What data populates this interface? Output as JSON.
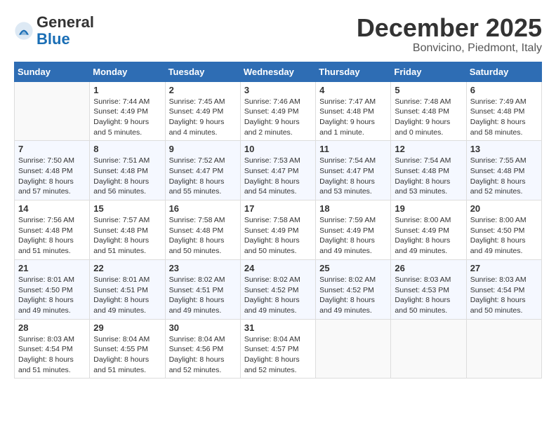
{
  "logo": {
    "general": "General",
    "blue": "Blue"
  },
  "header": {
    "month": "December 2025",
    "location": "Bonvicino, Piedmont, Italy"
  },
  "weekdays": [
    "Sunday",
    "Monday",
    "Tuesday",
    "Wednesday",
    "Thursday",
    "Friday",
    "Saturday"
  ],
  "weeks": [
    [
      {
        "day": "",
        "info": ""
      },
      {
        "day": "1",
        "info": "Sunrise: 7:44 AM\nSunset: 4:49 PM\nDaylight: 9 hours\nand 5 minutes."
      },
      {
        "day": "2",
        "info": "Sunrise: 7:45 AM\nSunset: 4:49 PM\nDaylight: 9 hours\nand 4 minutes."
      },
      {
        "day": "3",
        "info": "Sunrise: 7:46 AM\nSunset: 4:49 PM\nDaylight: 9 hours\nand 2 minutes."
      },
      {
        "day": "4",
        "info": "Sunrise: 7:47 AM\nSunset: 4:48 PM\nDaylight: 9 hours\nand 1 minute."
      },
      {
        "day": "5",
        "info": "Sunrise: 7:48 AM\nSunset: 4:48 PM\nDaylight: 9 hours\nand 0 minutes."
      },
      {
        "day": "6",
        "info": "Sunrise: 7:49 AM\nSunset: 4:48 PM\nDaylight: 8 hours\nand 58 minutes."
      }
    ],
    [
      {
        "day": "7",
        "info": "Sunrise: 7:50 AM\nSunset: 4:48 PM\nDaylight: 8 hours\nand 57 minutes."
      },
      {
        "day": "8",
        "info": "Sunrise: 7:51 AM\nSunset: 4:48 PM\nDaylight: 8 hours\nand 56 minutes."
      },
      {
        "day": "9",
        "info": "Sunrise: 7:52 AM\nSunset: 4:47 PM\nDaylight: 8 hours\nand 55 minutes."
      },
      {
        "day": "10",
        "info": "Sunrise: 7:53 AM\nSunset: 4:47 PM\nDaylight: 8 hours\nand 54 minutes."
      },
      {
        "day": "11",
        "info": "Sunrise: 7:54 AM\nSunset: 4:47 PM\nDaylight: 8 hours\nand 53 minutes."
      },
      {
        "day": "12",
        "info": "Sunrise: 7:54 AM\nSunset: 4:48 PM\nDaylight: 8 hours\nand 53 minutes."
      },
      {
        "day": "13",
        "info": "Sunrise: 7:55 AM\nSunset: 4:48 PM\nDaylight: 8 hours\nand 52 minutes."
      }
    ],
    [
      {
        "day": "14",
        "info": "Sunrise: 7:56 AM\nSunset: 4:48 PM\nDaylight: 8 hours\nand 51 minutes."
      },
      {
        "day": "15",
        "info": "Sunrise: 7:57 AM\nSunset: 4:48 PM\nDaylight: 8 hours\nand 51 minutes."
      },
      {
        "day": "16",
        "info": "Sunrise: 7:58 AM\nSunset: 4:48 PM\nDaylight: 8 hours\nand 50 minutes."
      },
      {
        "day": "17",
        "info": "Sunrise: 7:58 AM\nSunset: 4:49 PM\nDaylight: 8 hours\nand 50 minutes."
      },
      {
        "day": "18",
        "info": "Sunrise: 7:59 AM\nSunset: 4:49 PM\nDaylight: 8 hours\nand 49 minutes."
      },
      {
        "day": "19",
        "info": "Sunrise: 8:00 AM\nSunset: 4:49 PM\nDaylight: 8 hours\nand 49 minutes."
      },
      {
        "day": "20",
        "info": "Sunrise: 8:00 AM\nSunset: 4:50 PM\nDaylight: 8 hours\nand 49 minutes."
      }
    ],
    [
      {
        "day": "21",
        "info": "Sunrise: 8:01 AM\nSunset: 4:50 PM\nDaylight: 8 hours\nand 49 minutes."
      },
      {
        "day": "22",
        "info": "Sunrise: 8:01 AM\nSunset: 4:51 PM\nDaylight: 8 hours\nand 49 minutes."
      },
      {
        "day": "23",
        "info": "Sunrise: 8:02 AM\nSunset: 4:51 PM\nDaylight: 8 hours\nand 49 minutes."
      },
      {
        "day": "24",
        "info": "Sunrise: 8:02 AM\nSunset: 4:52 PM\nDaylight: 8 hours\nand 49 minutes."
      },
      {
        "day": "25",
        "info": "Sunrise: 8:02 AM\nSunset: 4:52 PM\nDaylight: 8 hours\nand 49 minutes."
      },
      {
        "day": "26",
        "info": "Sunrise: 8:03 AM\nSunset: 4:53 PM\nDaylight: 8 hours\nand 50 minutes."
      },
      {
        "day": "27",
        "info": "Sunrise: 8:03 AM\nSunset: 4:54 PM\nDaylight: 8 hours\nand 50 minutes."
      }
    ],
    [
      {
        "day": "28",
        "info": "Sunrise: 8:03 AM\nSunset: 4:54 PM\nDaylight: 8 hours\nand 51 minutes."
      },
      {
        "day": "29",
        "info": "Sunrise: 8:04 AM\nSunset: 4:55 PM\nDaylight: 8 hours\nand 51 minutes."
      },
      {
        "day": "30",
        "info": "Sunrise: 8:04 AM\nSunset: 4:56 PM\nDaylight: 8 hours\nand 52 minutes."
      },
      {
        "day": "31",
        "info": "Sunrise: 8:04 AM\nSunset: 4:57 PM\nDaylight: 8 hours\nand 52 minutes."
      },
      {
        "day": "",
        "info": ""
      },
      {
        "day": "",
        "info": ""
      },
      {
        "day": "",
        "info": ""
      }
    ]
  ]
}
